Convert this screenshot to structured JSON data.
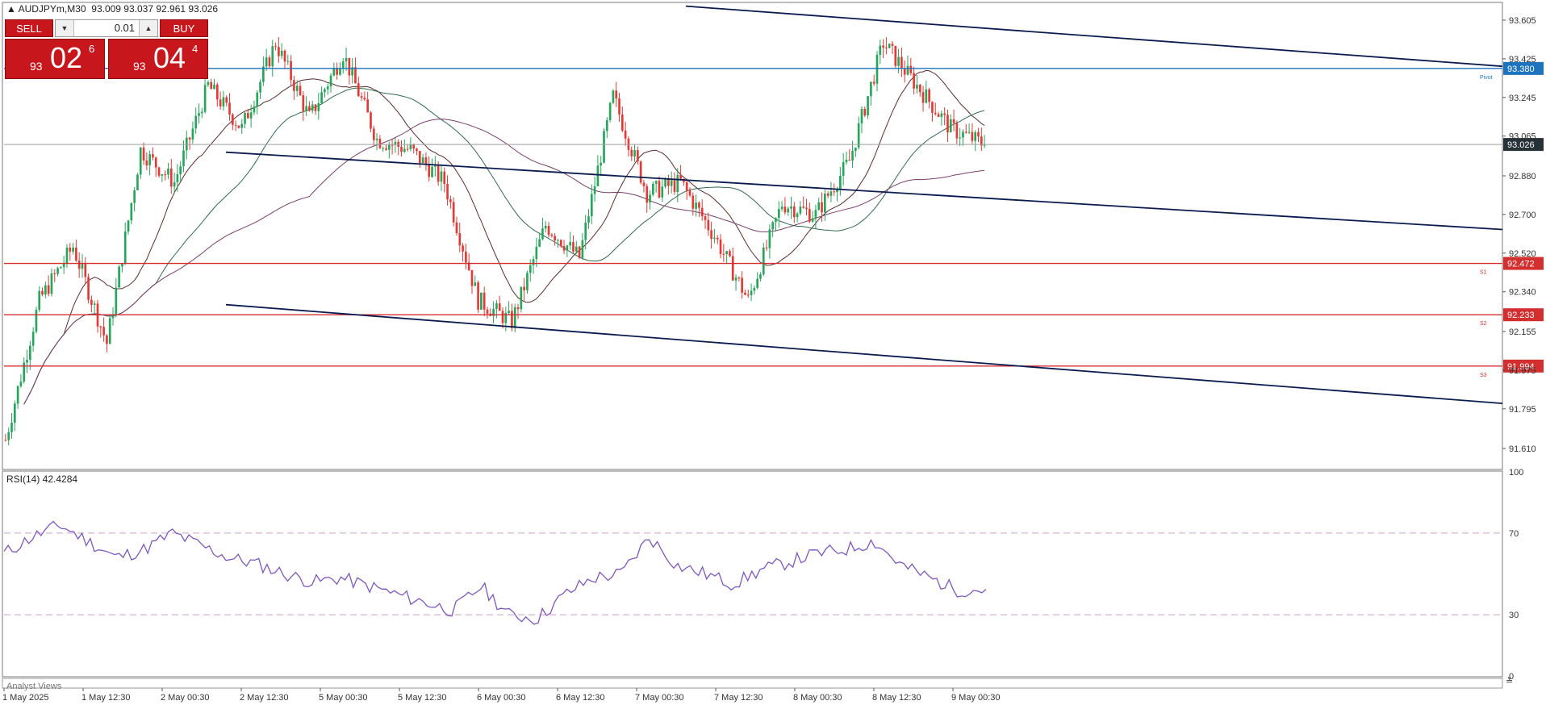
{
  "header": {
    "symbol_label": "AUDJPYm,M30",
    "ohlc": "93.009 93.037 92.961 93.026"
  },
  "trade_panel": {
    "sell_label": "SELL",
    "buy_label": "BUY",
    "lot": "0.01",
    "sell_price_prefix": "93",
    "sell_price_big": "02",
    "sell_price_sup": "6",
    "buy_price_prefix": "93",
    "buy_price_big": "04",
    "buy_price_sup": "4"
  },
  "rsi_label": "RSI(14) 42.4284",
  "analyst_tab": "Analyst Views",
  "colors": {
    "bull": "#26a65b",
    "bear": "#e53935",
    "pivot": "#1e73be",
    "support": "#d32f2f",
    "channel": "#0a1b4f",
    "rsi": "#7e57c2",
    "current": "#263238",
    "ma_fast": "#5d2c2c",
    "ma_mid": "#2e6b4f",
    "ma_slow": "#7b3f6b"
  },
  "chart_data": [
    {
      "type": "candlestick",
      "ylim": [
        91.52,
        93.68
      ],
      "y_ticks": [
        93.605,
        93.425,
        93.245,
        93.065,
        92.88,
        92.7,
        92.52,
        92.34,
        92.155,
        91.975,
        91.795,
        91.61
      ],
      "x_ticks": [
        "1 May 2025",
        "1 May 12:30",
        "2 May 00:30",
        "2 May 12:30",
        "5 May 00:30",
        "5 May 12:30",
        "6 May 00:30",
        "6 May 12:30",
        "7 May 00:30",
        "7 May 12:30",
        "8 May 00:30",
        "8 May 12:30",
        "9 May 00:30"
      ],
      "price_path": [
        91.65,
        92.3,
        92.55,
        92.1,
        93.0,
        92.85,
        93.3,
        93.1,
        93.5,
        93.15,
        93.45,
        93.05,
        93.0,
        92.85,
        92.3,
        92.2,
        92.65,
        92.5,
        93.25,
        92.8,
        92.85,
        92.6,
        92.3,
        92.75,
        92.7,
        92.95,
        93.5,
        93.3,
        93.1,
        93.026
      ],
      "current_price": 93.026,
      "levels": [
        {
          "name": "Pivot",
          "value": 93.38
        },
        {
          "name": "S1",
          "value": 92.472
        },
        {
          "name": "S2",
          "value": 92.233
        },
        {
          "name": "S3",
          "value": 91.994
        }
      ]
    },
    {
      "type": "line",
      "title": "RSI(14) 42.4284",
      "ylim": [
        0,
        100
      ],
      "y_ticks": [
        100,
        70,
        30,
        0
      ],
      "levels": [
        70,
        30
      ],
      "rsi_path": [
        60,
        68,
        74,
        66,
        58,
        62,
        70,
        64,
        58,
        55,
        50,
        46,
        48,
        44,
        40,
        36,
        32,
        44,
        30,
        28,
        40,
        48,
        50,
        68,
        54,
        50,
        45,
        52,
        56,
        60,
        62,
        66,
        54,
        48,
        42,
        42.43
      ]
    }
  ]
}
